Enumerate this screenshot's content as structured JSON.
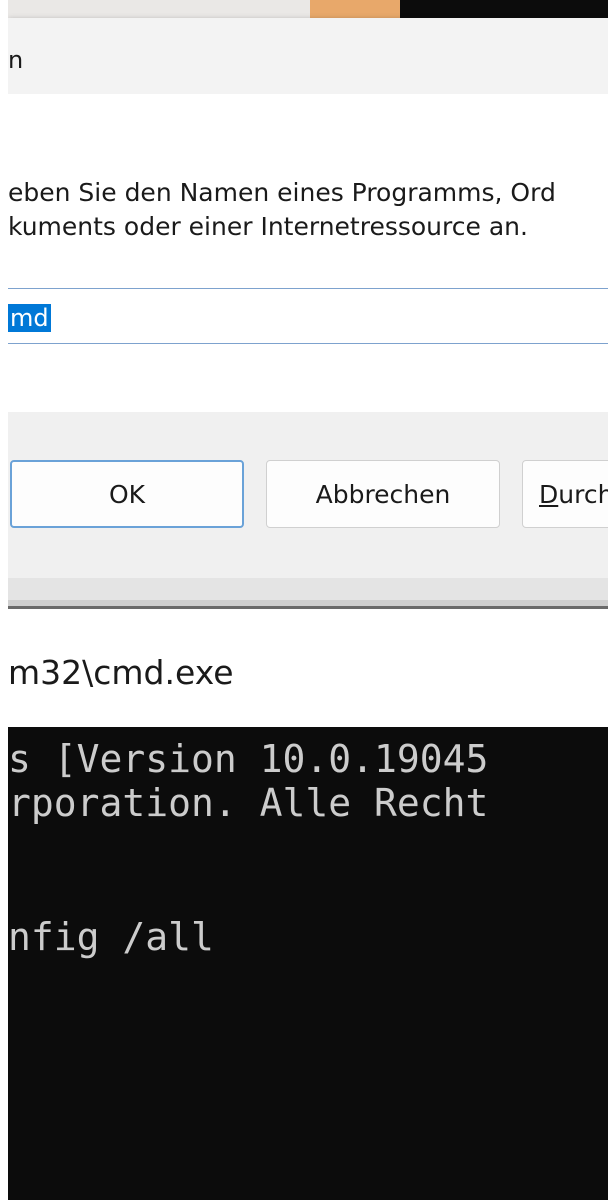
{
  "run_dialog": {
    "title": "n",
    "description_line1": "eben Sie den Namen eines Programms, Ord",
    "description_line2": "kuments oder einer Internetressource an.",
    "input_value": "md",
    "ok_label": "OK",
    "cancel_label": "Abbrechen",
    "browse_label_accel": "D",
    "browse_label_rest": "urch"
  },
  "cmd_window": {
    "title": "m32\\cmd.exe",
    "lines": [
      "s [Version 10.0.19045",
      "rporation. Alle Recht",
      "nfig /all"
    ]
  },
  "colors": {
    "selection": "#0078d7",
    "console_bg": "#0c0c0c",
    "console_text": "#cccccc",
    "ok_border": "#6aa2d8"
  }
}
